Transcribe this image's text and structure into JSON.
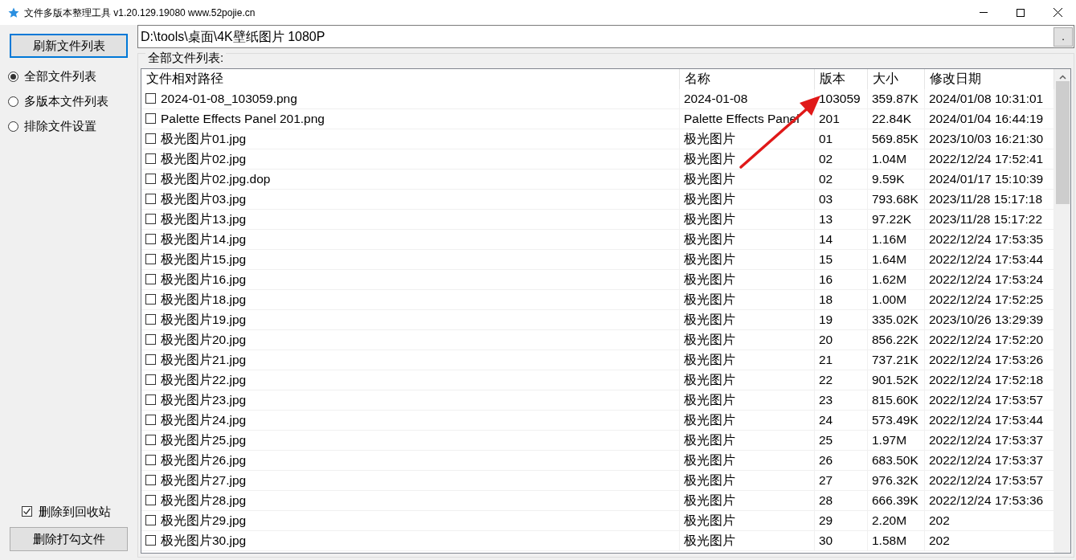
{
  "window": {
    "title": "文件多版本整理工具 v1.20.129.19080 www.52pojie.cn"
  },
  "sidebar": {
    "refresh_button": "刷新文件列表",
    "views": [
      {
        "label": "全部文件列表",
        "selected": true
      },
      {
        "label": "多版本文件列表",
        "selected": false
      },
      {
        "label": "排除文件设置",
        "selected": false
      }
    ],
    "recycle_option": {
      "label": "删除到回收站",
      "checked": true
    },
    "delete_button": "删除打勾文件"
  },
  "path_field": {
    "value": "D:\\tools\\桌面\\4K壁纸图片 1080P",
    "browse_button": "."
  },
  "file_list": {
    "title": "全部文件列表:",
    "columns": [
      "文件相对路径",
      "名称",
      "版本",
      "大小",
      "修改日期"
    ],
    "rows": [
      {
        "checked": false,
        "cells": [
          "2024-01-08_103059.png",
          "2024-01-08",
          "103059",
          "359.87K",
          "2024/01/08 10:31:01"
        ]
      },
      {
        "checked": false,
        "cells": [
          "Palette Effects Panel 201.png",
          "Palette Effects Panel",
          "201",
          "22.84K",
          "2024/01/04 16:44:19"
        ]
      },
      {
        "checked": false,
        "cells": [
          "极光图片01.jpg",
          "极光图片",
          "01",
          "569.85K",
          "2023/10/03 16:21:30"
        ]
      },
      {
        "checked": false,
        "cells": [
          "极光图片02.jpg",
          "极光图片",
          "02",
          "1.04M",
          "2022/12/24 17:52:41"
        ]
      },
      {
        "checked": false,
        "cells": [
          "极光图片02.jpg.dop",
          "极光图片",
          "02",
          "9.59K",
          "2024/01/17 15:10:39"
        ]
      },
      {
        "checked": false,
        "cells": [
          "极光图片03.jpg",
          "极光图片",
          "03",
          "793.68K",
          "2023/11/28 15:17:18"
        ]
      },
      {
        "checked": false,
        "cells": [
          "极光图片13.jpg",
          "极光图片",
          "13",
          "97.22K",
          "2023/11/28 15:17:22"
        ]
      },
      {
        "checked": false,
        "cells": [
          "极光图片14.jpg",
          "极光图片",
          "14",
          "1.16M",
          "2022/12/24 17:53:35"
        ]
      },
      {
        "checked": false,
        "cells": [
          "极光图片15.jpg",
          "极光图片",
          "15",
          "1.64M",
          "2022/12/24 17:53:44"
        ]
      },
      {
        "checked": false,
        "cells": [
          "极光图片16.jpg",
          "极光图片",
          "16",
          "1.62M",
          "2022/12/24 17:53:24"
        ]
      },
      {
        "checked": false,
        "cells": [
          "极光图片18.jpg",
          "极光图片",
          "18",
          "1.00M",
          "2022/12/24 17:52:25"
        ]
      },
      {
        "checked": false,
        "cells": [
          "极光图片19.jpg",
          "极光图片",
          "19",
          "335.02K",
          "2023/10/26 13:29:39"
        ]
      },
      {
        "checked": false,
        "cells": [
          "极光图片20.jpg",
          "极光图片",
          "20",
          "856.22K",
          "2022/12/24 17:52:20"
        ]
      },
      {
        "checked": false,
        "cells": [
          "极光图片21.jpg",
          "极光图片",
          "21",
          "737.21K",
          "2022/12/24 17:53:26"
        ]
      },
      {
        "checked": false,
        "cells": [
          "极光图片22.jpg",
          "极光图片",
          "22",
          "901.52K",
          "2022/12/24 17:52:18"
        ]
      },
      {
        "checked": false,
        "cells": [
          "极光图片23.jpg",
          "极光图片",
          "23",
          "815.60K",
          "2022/12/24 17:53:57"
        ]
      },
      {
        "checked": false,
        "cells": [
          "极光图片24.jpg",
          "极光图片",
          "24",
          "573.49K",
          "2022/12/24 17:53:44"
        ]
      },
      {
        "checked": false,
        "cells": [
          "极光图片25.jpg",
          "极光图片",
          "25",
          "1.97M",
          "2022/12/24 17:53:37"
        ]
      },
      {
        "checked": false,
        "cells": [
          "极光图片26.jpg",
          "极光图片",
          "26",
          "683.50K",
          "2022/12/24 17:53:37"
        ]
      },
      {
        "checked": false,
        "cells": [
          "极光图片27.jpg",
          "极光图片",
          "27",
          "976.32K",
          "2022/12/24 17:53:57"
        ]
      },
      {
        "checked": false,
        "cells": [
          "极光图片28.jpg",
          "极光图片",
          "28",
          "666.39K",
          "2022/12/24 17:53:36"
        ]
      },
      {
        "checked": false,
        "cells": [
          "极光图片29.jpg",
          "极光图片",
          "29",
          "2.20M",
          "202"
        ]
      },
      {
        "checked": false,
        "cells": [
          "极光图片30.jpg",
          "极光图片",
          "30",
          "1.58M",
          "202"
        ]
      }
    ]
  },
  "annotations": [
    {
      "kind": "arrow"
    }
  ]
}
